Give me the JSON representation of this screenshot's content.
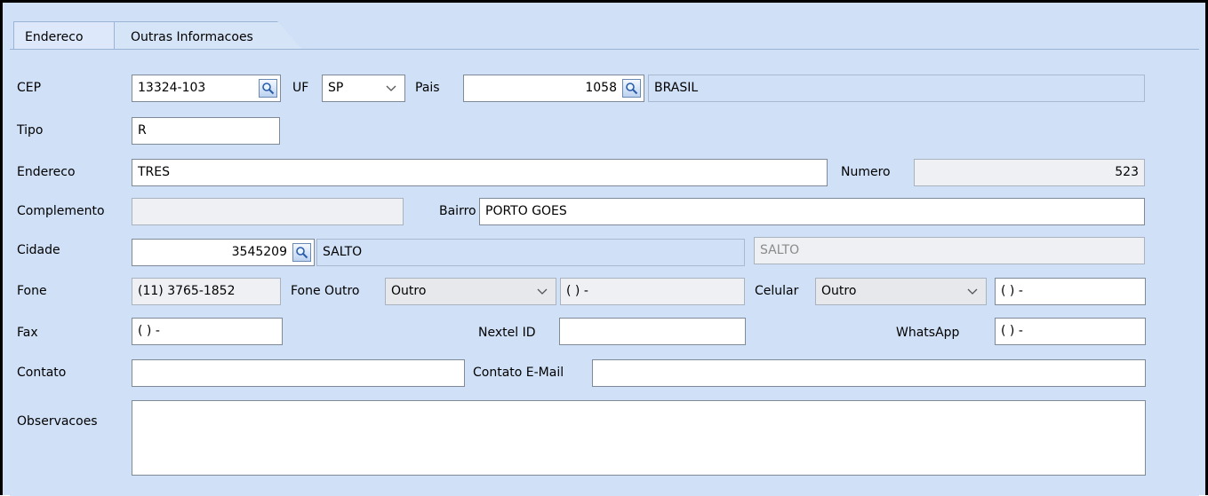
{
  "tabs": [
    {
      "label": "Endereco",
      "active": true
    },
    {
      "label": "Outras Informacoes",
      "active": false
    }
  ],
  "form": {
    "cep": {
      "label": "CEP",
      "value": "13324-103"
    },
    "uf": {
      "label": "UF",
      "value": "SP"
    },
    "pais": {
      "label": "Pais",
      "code": "1058",
      "name": "BRASIL"
    },
    "tipo": {
      "label": "Tipo",
      "value": "R"
    },
    "endereco": {
      "label": "Endereco",
      "value": "TRES"
    },
    "numero": {
      "label": "Numero",
      "value": "523"
    },
    "complemento": {
      "label": "Complemento",
      "value": ""
    },
    "bairro": {
      "label": "Bairro",
      "value": "PORTO GOES"
    },
    "cidade": {
      "label": "Cidade",
      "code": "3545209",
      "name": "SALTO",
      "name_alt": "SALTO"
    },
    "fone": {
      "label": "Fone",
      "value": "(11) 3765-1852"
    },
    "fone_outro": {
      "label": "Fone Outro",
      "type": "Outro",
      "value": "( )   -"
    },
    "celular": {
      "label": "Celular",
      "type": "Outro",
      "value": "( )   -"
    },
    "fax": {
      "label": "Fax",
      "value": "( )   -"
    },
    "nextel": {
      "label": "Nextel ID",
      "value": ""
    },
    "whatsapp": {
      "label": "WhatsApp",
      "value": "( )   -"
    },
    "contato": {
      "label": "Contato",
      "value": ""
    },
    "contato_email": {
      "label": "Contato E-Mail",
      "value": ""
    },
    "observacoes": {
      "label": "Observacoes",
      "value": ""
    }
  },
  "icons": {
    "lookup": "magnifier-icon",
    "dropdown": "chevron-down-icon"
  }
}
